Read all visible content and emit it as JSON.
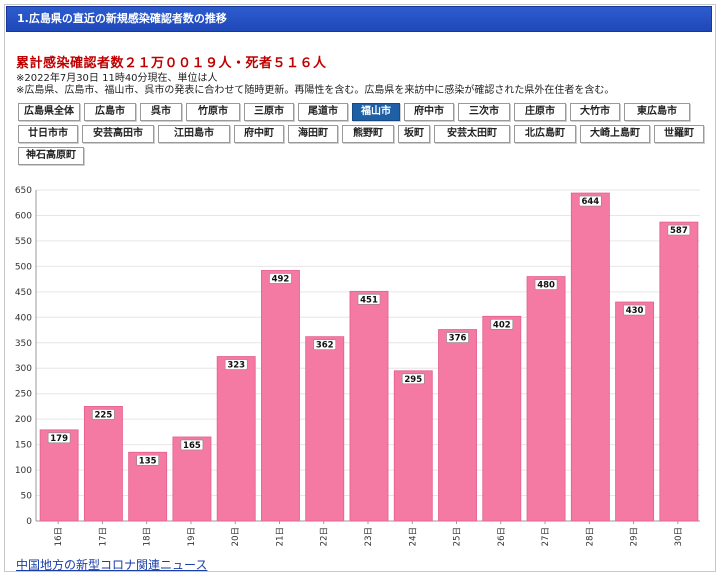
{
  "header": {
    "title": "1.広島県の直近の新規感染確認者数の推移"
  },
  "summary": {
    "totals": "累計感染確認者数２１万００１９人・死者５１６人",
    "note1": "※2022年7月30日 11時40分現在、単位は人",
    "note2": "※広島県、広島市、福山市、呉市の発表に合わせて随時更新。再陽性を含む。広島県を来訪中に感染が確認された県外在住者を含む。"
  },
  "areas": [
    "広島県全体",
    "広島市",
    "呉市",
    "竹原市",
    "三原市",
    "尾道市",
    "福山市",
    "府中市",
    "三次市",
    "庄原市",
    "大竹市",
    "東広島市",
    "廿日市市",
    "安芸高田市",
    "江田島市",
    "府中町",
    "海田町",
    "熊野町",
    "坂町",
    "安芸太田町",
    "北広島町",
    "大崎上島町",
    "世羅町",
    "神石高原町"
  ],
  "active_area": "福山市",
  "colors": {
    "bar": "#f47aa3",
    "bar_edge": "#e45f8c",
    "header": "#2450c4",
    "totals": "#c00000",
    "active": "#1f5fa6"
  },
  "chart_data": {
    "type": "bar",
    "categories": [
      "16日",
      "17日",
      "18日",
      "19日",
      "20日",
      "21日",
      "22日",
      "23日",
      "24日",
      "25日",
      "26日",
      "27日",
      "28日",
      "29日",
      "30日"
    ],
    "values": [
      179,
      225,
      135,
      165,
      323,
      492,
      362,
      451,
      295,
      376,
      402,
      480,
      644,
      430,
      587
    ],
    "ylim": [
      0,
      650
    ],
    "yticks": [
      0,
      50,
      100,
      150,
      200,
      250,
      300,
      350,
      400,
      450,
      500,
      550,
      600,
      650
    ],
    "grid": true,
    "xlabel": "",
    "ylabel": "",
    "title": ""
  },
  "footer": {
    "link": "中国地方の新型コロナ関連ニュース"
  }
}
